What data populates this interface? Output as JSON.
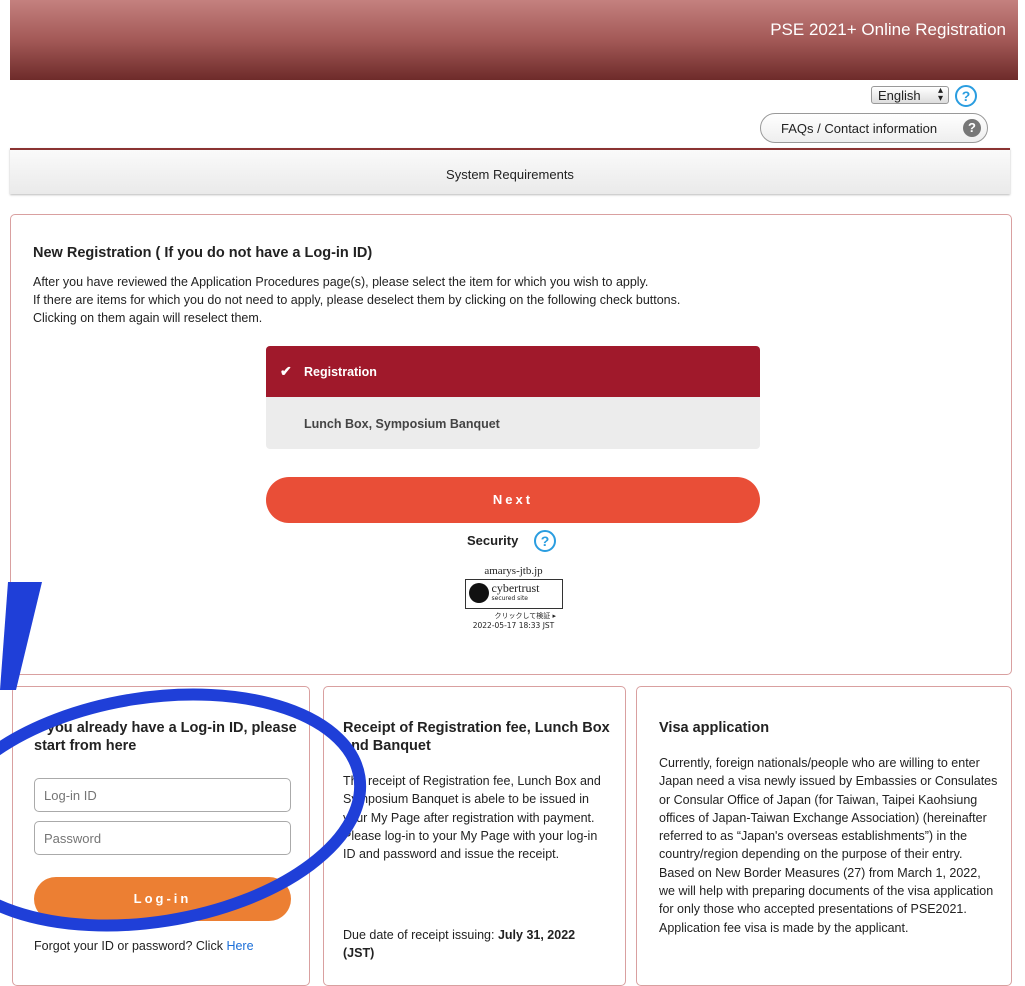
{
  "header": {
    "title": "PSE 2021+ Online Registration"
  },
  "language": {
    "selected": "English"
  },
  "faq": {
    "label": "FAQs / Contact information"
  },
  "system_requirements": {
    "label": "System Requirements"
  },
  "new_registration": {
    "title": "New Registration ( If you do not have a Log-in ID)",
    "lines": [
      "After you have reviewed the Application Procedures page(s), please select the item for which you wish to apply.",
      "If there are items for which you do not need to apply, please deselect them by clicking on the following check buttons.",
      "Clicking on them again will reselect them."
    ],
    "items": [
      {
        "label": "Registration",
        "selected": true
      },
      {
        "label": "Lunch Box, Symposium Banquet",
        "selected": false
      }
    ],
    "next_label": "Next",
    "security_label": "Security",
    "badge": {
      "domain": "amarys-jtb.jp",
      "brand": "cybertrust",
      "sub": "secured site",
      "verify": "クリックして検証 ▸",
      "timestamp": "2022-05-17 18:33 JST"
    }
  },
  "login": {
    "title": "If you already have a Log-in ID, please start from here",
    "id_placeholder": "Log-in ID",
    "password_placeholder": "Password",
    "button_label": "Log-in",
    "forgot_text": "Forgot your ID or password? Click",
    "forgot_link": "Here"
  },
  "receipt": {
    "title": "Receipt of Registration fee, Lunch Box and Banquet",
    "body": "The receipt of Registration fee, Lunch Box and Symposium Banquet is abele to be issued in your My Page after registration with payment. Please log-in to your My Page with your log-in ID and password and issue the receipt.",
    "due_prefix": "Due date of receipt issuing:",
    "due_date": "July 31, 2022 (JST)"
  },
  "visa": {
    "title": "Visa application",
    "body": "Currently, foreign nationals/people who are willing to enter Japan need a visa newly issued by Embassies or Consulates or Consular Office of Japan (for Taiwan, Taipei Kaohsiung offices of Japan-Taiwan Exchange Association) (hereinafter referred to as “Japan's overseas establishments”) in the country/region depending on the purpose of their entry. Based on New Border Measures (27) from March 1, 2022, we will help with preparing documents of the visa application for only those who accepted presentations of PSE2021. Application fee visa is made by the applicant."
  },
  "colors": {
    "brand_dark": "#6e2b2a",
    "selected_item": "#a0192b",
    "next_button": "#e94e37",
    "login_button": "#ec7f33",
    "link": "#1a6ed8",
    "annotation": "#1f3fd8"
  }
}
